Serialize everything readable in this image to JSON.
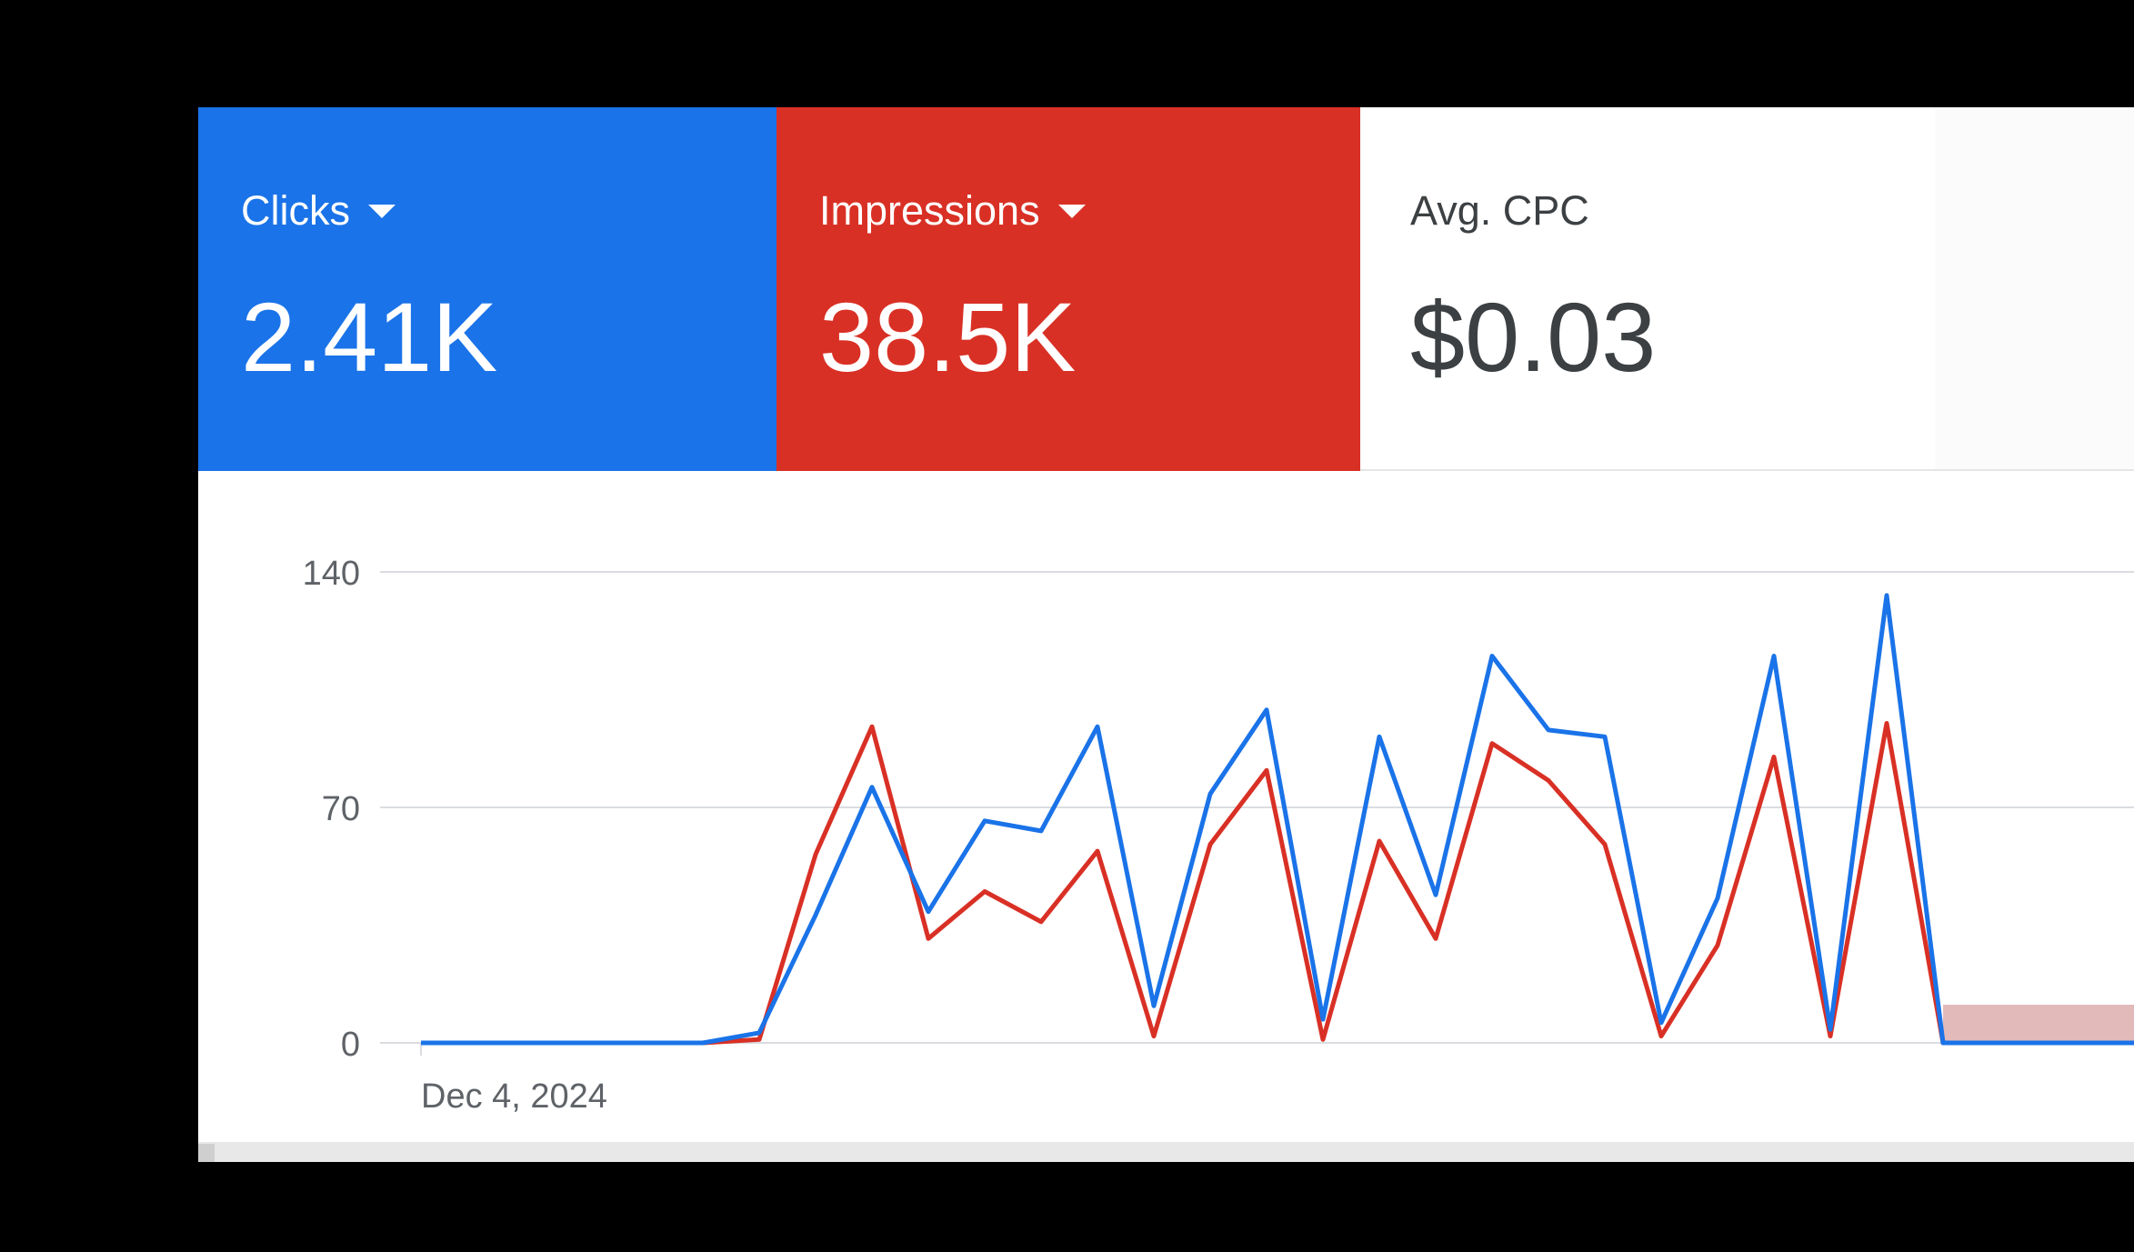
{
  "tiles": [
    {
      "label": "Clicks",
      "value": "2.41K",
      "color": "#1a73e8",
      "has_dropdown": true
    },
    {
      "label": "Impressions",
      "value": "38.5K",
      "color": "#d93025",
      "has_dropdown": true
    },
    {
      "label": "Avg. CPC",
      "value": "$0.03",
      "color": "#ffffff",
      "has_dropdown": false
    }
  ],
  "icons": {
    "dropdown": "caret-down-icon"
  },
  "chart_data": {
    "type": "line",
    "x_start_label": "Dec 4, 2024",
    "yticks": [
      "140",
      "70",
      "0"
    ],
    "ylim": [
      0,
      140
    ],
    "grid": true,
    "series": [
      {
        "name": "Clicks",
        "color": "#1a73e8",
        "values": [
          0,
          0,
          0,
          0,
          0,
          0,
          3,
          38,
          76,
          39,
          66,
          63,
          94,
          11,
          74,
          99,
          7,
          91,
          44,
          115,
          93,
          91,
          6,
          43,
          115,
          4,
          133,
          0,
          0,
          0,
          0,
          0
        ]
      },
      {
        "name": "Impressions",
        "color": "#d93025",
        "values": [
          0,
          0,
          0,
          0,
          0,
          0,
          1,
          56,
          94,
          31,
          45,
          36,
          57,
          2,
          59,
          81,
          1,
          60,
          31,
          89,
          78,
          59,
          2,
          29,
          85,
          2,
          95,
          0,
          0,
          0,
          0,
          0
        ]
      }
    ]
  }
}
